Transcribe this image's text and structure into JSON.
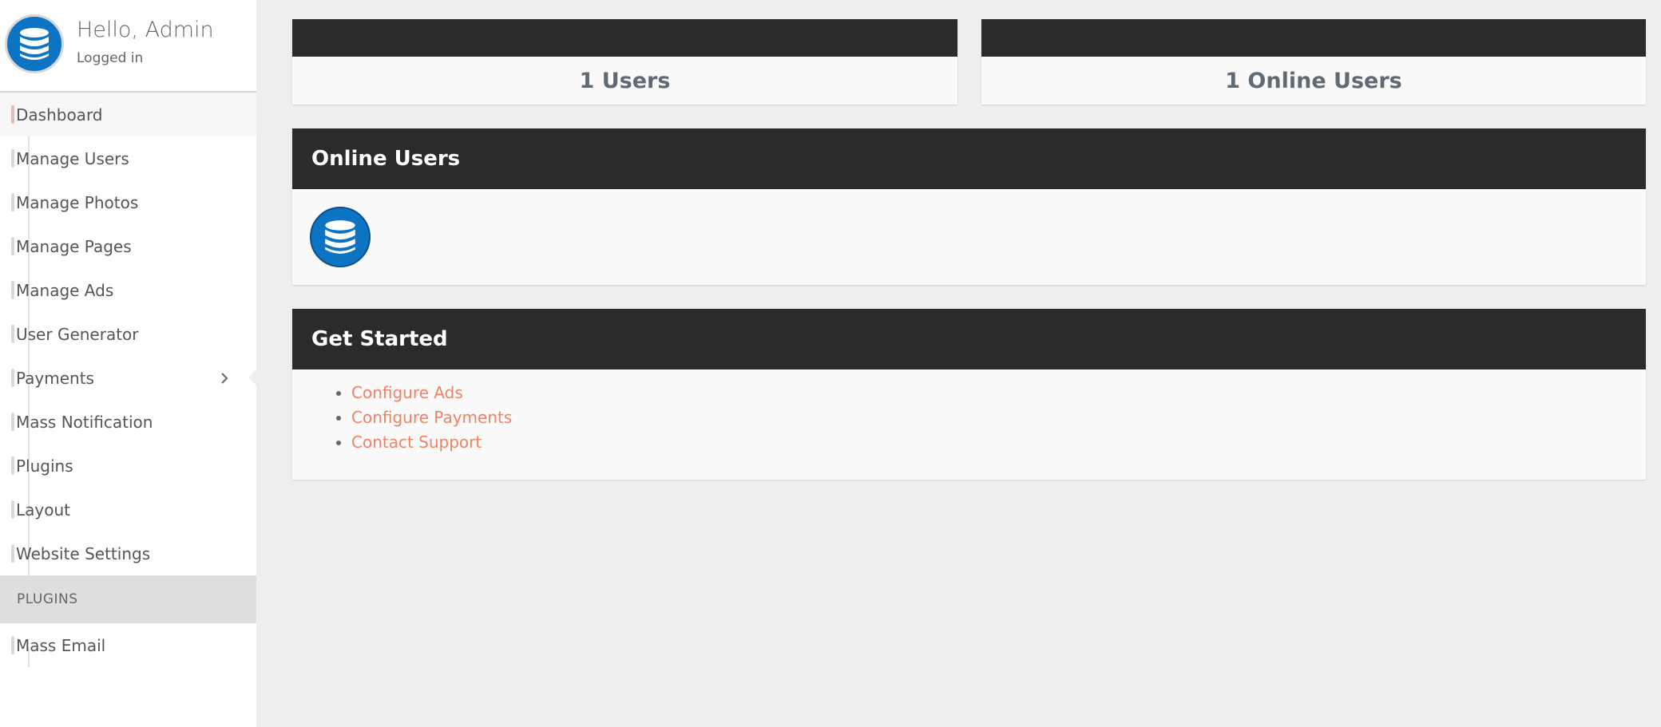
{
  "sidebar": {
    "greeting": "Hello, Admin",
    "status": "Logged in",
    "items": [
      {
        "label": "Dashboard",
        "active": true
      },
      {
        "label": "Manage Users"
      },
      {
        "label": "Manage Photos"
      },
      {
        "label": "Manage Pages"
      },
      {
        "label": "Manage Ads"
      },
      {
        "label": "User Generator"
      },
      {
        "label": "Payments",
        "has_submenu": true
      },
      {
        "label": "Mass Notification"
      },
      {
        "label": "Plugins"
      },
      {
        "label": "Layout"
      },
      {
        "label": "Website Settings"
      }
    ],
    "plugins_header": "PLUGINS",
    "plugin_items": [
      {
        "label": "Mass Email"
      }
    ]
  },
  "stats": {
    "users": "1 Users",
    "online_users": "1 Online Users"
  },
  "online_panel": {
    "title": "Online Users"
  },
  "get_started": {
    "title": "Get Started",
    "links": [
      "Configure Ads",
      "Configure Payments",
      "Contact Support"
    ]
  },
  "colors": {
    "brand_blue": "#0d74c4",
    "dark_header": "#2b2b2b",
    "link": "#ee8363"
  },
  "icons": {
    "avatar": "database-icon",
    "submenu": "chevron-right-icon"
  }
}
